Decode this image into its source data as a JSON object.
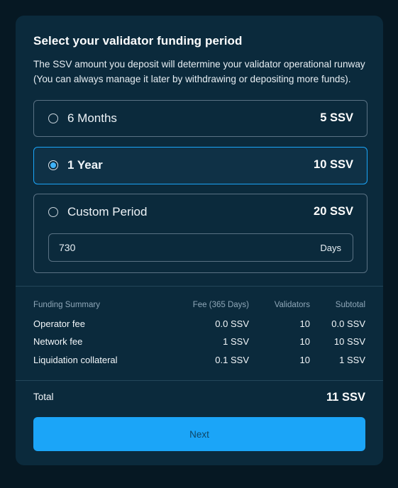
{
  "header": {
    "title": "Select your validator funding period",
    "description": "The SSV amount you deposit will determine your validator operational runway (You can always manage it later by withdrawing or depositing more funds)."
  },
  "options": [
    {
      "label": "6 Months",
      "price": "5 SSV",
      "selected": false
    },
    {
      "label": "1 Year",
      "price": "10 SSV",
      "selected": true
    },
    {
      "label": "Custom Period",
      "price": "20 SSV",
      "selected": false
    }
  ],
  "custom_period": {
    "value": "730",
    "suffix": "Days"
  },
  "summary": {
    "headers": {
      "title": "Funding Summary",
      "fee": "Fee (365 Days)",
      "validators": "Validators",
      "subtotal": "Subtotal"
    },
    "rows": [
      {
        "label": "Operator fee",
        "fee": "0.0 SSV",
        "validators": "10",
        "subtotal": "0.0 SSV"
      },
      {
        "label": "Network fee",
        "fee": "1 SSV",
        "validators": "10",
        "subtotal": "10 SSV"
      },
      {
        "label": "Liquidation collateral",
        "fee": "0.1 SSV",
        "validators": "10",
        "subtotal": "1 SSV"
      }
    ]
  },
  "total": {
    "label": "Total",
    "value": "11 SSV"
  },
  "next_button": {
    "label": "Next"
  },
  "colors": {
    "page_background": "#061823",
    "card_background": "#0b2a3c",
    "accent": "#1ba5f8",
    "border": "#5a7284"
  }
}
